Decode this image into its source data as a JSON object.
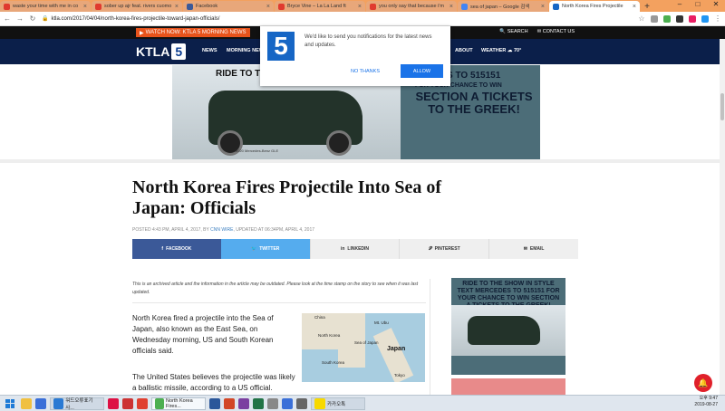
{
  "browser": {
    "tabs": [
      {
        "title": "waste your time with me in co",
        "color": "#e03a2f",
        "active": false
      },
      {
        "title": "sober up ajr feat. rivers cuomo",
        "color": "#e03a2f",
        "active": false
      },
      {
        "title": "Facebook",
        "color": "#3b5998",
        "active": false
      },
      {
        "title": "Bryce Vine – La La Land ft",
        "color": "#e03a2f",
        "active": false
      },
      {
        "title": "you only say that because i'm",
        "color": "#e03a2f",
        "active": false
      },
      {
        "title": "sea of japan – Google 검색",
        "color": "#4285f4",
        "active": false
      },
      {
        "title": "North Korea Fires Projectile",
        "color": "#1666c5",
        "active": true
      }
    ],
    "url": "ktla.com/2017/04/04/north-korea-fires-projectile-toward-japan-officials/"
  },
  "site": {
    "watch_now": "WATCH NOW: KTLA 5 MORNING NEWS",
    "search": "SEARCH",
    "contact": "CONTACT US",
    "logo_text": "KTLA",
    "logo_num": "5",
    "nav": [
      "NEWS",
      "MORNING NEWS",
      "ABOUT",
      "WEATHER ☁ 70°"
    ]
  },
  "notification": {
    "message": "We'd like to send you notifications for the latest news and updates.",
    "no_label": "NO THANKS",
    "allow_label": "ALLOW"
  },
  "ad_banner": {
    "left_text": "RIDE TO T",
    "right_top": "RCEDES TO 515151",
    "right_sub": "FOR YOUR CHANCE TO WIN",
    "right_big": "SECTION A TICKETS TO THE GREEK!",
    "caption": "2020 Mercedes-Benz GLE"
  },
  "article": {
    "headline": "North Korea Fires Projectile Into Sea of Japan: Officials",
    "posted": "POSTED 4:43 PM, APRIL 4, 2017, BY ",
    "author": "CNN WIRE",
    "updated": ", UPDATED AT 06:34PM, APRIL 4, 2017",
    "share": {
      "facebook": "FACEBOOK",
      "twitter": "TWITTER",
      "linkedin": "LINKEDIN",
      "pinterest": "PINTEREST",
      "email": "EMAIL"
    },
    "archive_note": "This is an archived article and the information in the article may be outdated. Please look at the time stamp on the story to see when it was last updated.",
    "para1": "North Korea fired a projectile into the Sea of Japan, also known as the East Sea, on Wednesday morning, US and South Korean officials said.",
    "para2": "The United States believes the projectile was likely a ballistic missile, according to a US official."
  },
  "map": {
    "labels": {
      "china": "China",
      "japan": "Japan",
      "tokyo": "Tokyo",
      "north_korea": "North Korea",
      "south_korea": "South Korea",
      "mt_ubu": "Mt. Ubu",
      "sea": "Sea of Japan"
    }
  },
  "sidebar_ad": {
    "text": "RIDE TO THE SHOW IN STYLE TEXT MERCEDES TO 515151 FOR YOUR CHANCE TO WIN SECTION A TICKETS TO THE GREEK!"
  },
  "taskbar": {
    "items": [
      {
        "label": "",
        "color": "#f0c040"
      },
      {
        "label": "",
        "color": "#3a6fd8"
      },
      {
        "label": "워드오류표기 사...",
        "color": "#2a7ad3",
        "button": true
      },
      {
        "label": "",
        "color": "#d14"
      },
      {
        "label": "",
        "color": "#c33"
      },
      {
        "label": "",
        "color": "#e04030"
      },
      {
        "label": "North Korea Fires...",
        "color": "#4caf50",
        "button": true,
        "active": true
      },
      {
        "label": "",
        "color": "#2b579a"
      },
      {
        "label": "",
        "color": "#d24726"
      },
      {
        "label": "",
        "color": "#7b3fa0"
      },
      {
        "label": "",
        "color": "#217346"
      },
      {
        "label": "",
        "color": "#888"
      },
      {
        "label": "",
        "color": "#3a6fd8"
      },
      {
        "label": "",
        "color": "#666"
      },
      {
        "label": "카카오톡",
        "color": "#f7d900",
        "button": true
      }
    ],
    "time": "오후 9:47",
    "date": "2019-08-27"
  }
}
